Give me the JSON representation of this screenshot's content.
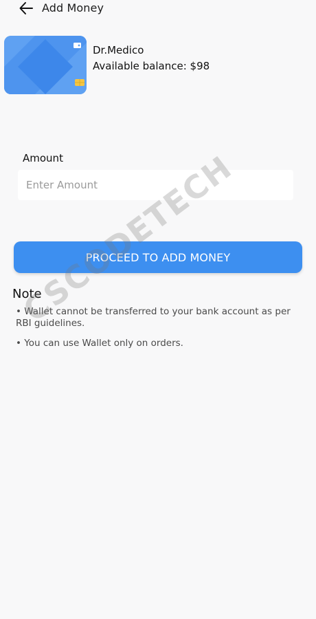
{
  "header": {
    "title": "Add Money",
    "back_icon": "arrow-left-icon"
  },
  "wallet": {
    "name": "Dr.Medico",
    "balance_text": "Available balance: $98",
    "card_color": "#5fa1f2",
    "chip_color": "#f5c542"
  },
  "amount": {
    "label": "Amount",
    "placeholder": "Enter Amount"
  },
  "proceed_button": {
    "label": "PROCEED TO ADD MONEY",
    "color": "#3d8ff0"
  },
  "note": {
    "title": "Note",
    "items": [
      "• Wallet cannot be transferred to your bank account as per RBI guidelines.",
      "• You can use Wallet only on orders."
    ]
  },
  "watermark": {
    "text": "CSCODETECH"
  }
}
